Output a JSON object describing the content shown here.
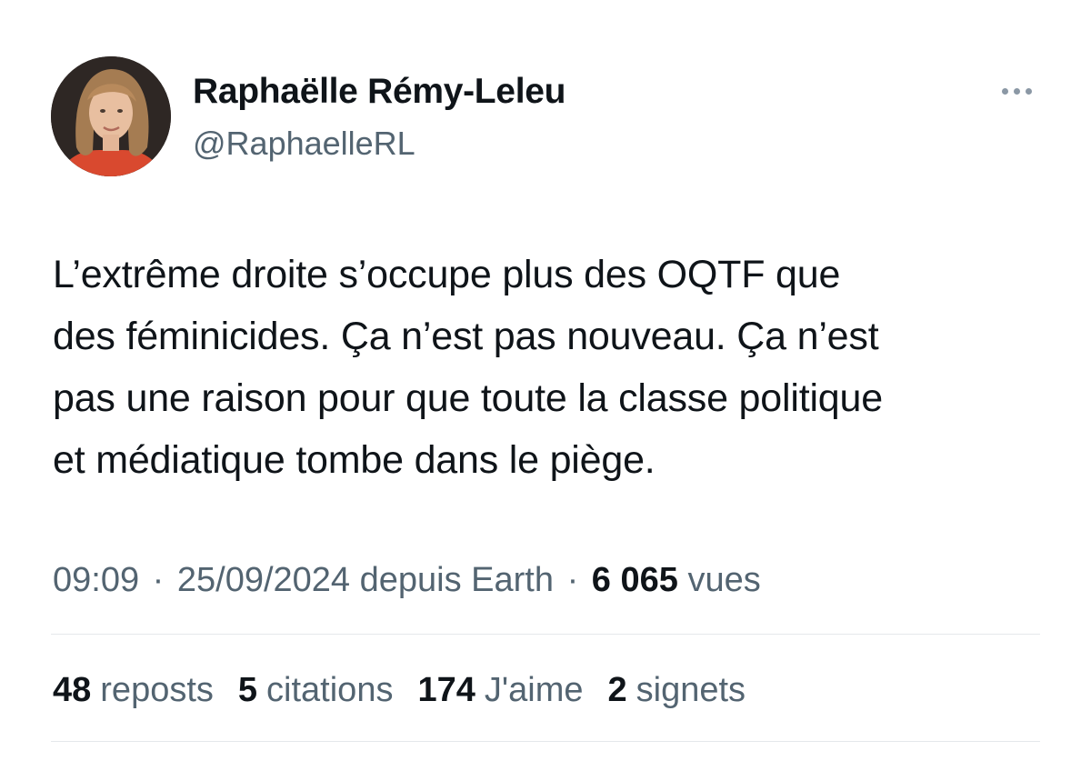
{
  "author": {
    "display_name": "Raphaëlle Rémy-Leleu",
    "handle": "@RaphaelleRL",
    "avatar_icon": "profile-photo"
  },
  "more_menu_icon": "more-horizontal-icon",
  "tweet": {
    "lines": [
      "L’extrême droite s’occupe plus des OQTF que",
      "des féminicides. Ça n’est pas nouveau. Ça n’est",
      "pas une raison pour que toute la classe politique",
      "et médiatique tombe dans le piège."
    ]
  },
  "meta": {
    "time": "09:09",
    "separator": "·",
    "date": "25/09/2024",
    "source": "depuis Earth",
    "views_count": "6 065",
    "views_label": "vues"
  },
  "stats": [
    {
      "count": "48",
      "label": "reposts"
    },
    {
      "count": "5",
      "label": "citations"
    },
    {
      "count": "174",
      "label": "J'aime"
    },
    {
      "count": "2",
      "label": "signets"
    }
  ],
  "colors": {
    "text_primary": "#0f1419",
    "text_secondary": "#536471",
    "divider": "#e5e8eb"
  }
}
